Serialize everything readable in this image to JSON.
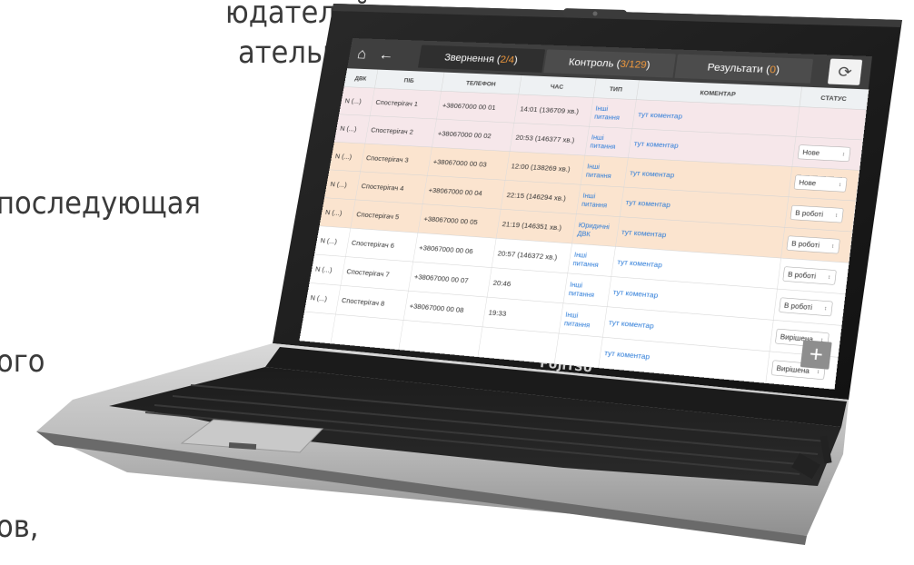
{
  "background_text": [
    {
      "text": "юдателей и"
    },
    {
      "text": "ательных"
    },
    {
      "text": "последующая"
    },
    {
      "text": "ого"
    },
    {
      "text": "ов,"
    }
  ],
  "laptop": {
    "brand": "FUJITSU"
  },
  "app": {
    "tabs": [
      {
        "label_prefix": "Звернення (",
        "highlight": "2/4",
        "label_suffix": ")",
        "active": true
      },
      {
        "label_prefix": "Контроль (",
        "highlight": "3/129",
        "label_suffix": ")",
        "active": false
      },
      {
        "label_prefix": "Результати (",
        "highlight": "0",
        "label_suffix": ")",
        "active": false
      }
    ],
    "columns": [
      "ДВК",
      "ПІБ",
      "ТЕЛЕФОН",
      "ЧАС",
      "ТИП",
      "КОМЕНТАР",
      "СТАТУС"
    ],
    "rows": [
      {
        "dvk": "N (...)",
        "pib": "Спостерігач 1",
        "phone": "+38067000 00 01",
        "time": "14:01 (136709 хв.)",
        "type": "Інші питання",
        "comment": "тут коментар",
        "status": ""
      },
      {
        "dvk": "N (...)",
        "pib": "Спостерігач 2",
        "phone": "+38067000 00 02",
        "time": "20:53 (146377 хв.)",
        "type": "Інші питання",
        "comment": "тут коментар",
        "status": "Нове"
      },
      {
        "dvk": "N (...)",
        "pib": "Спостерігач 3",
        "phone": "+38067000 00 03",
        "time": "12:00 (138269 хв.)",
        "type": "Інші питання",
        "comment": "тут коментар",
        "status": "Нове"
      },
      {
        "dvk": "N (...)",
        "pib": "Спостерігач 4",
        "phone": "+38067000 00 04",
        "time": "22:15 (146294 хв.)",
        "type": "Інші питання",
        "comment": "тут коментар",
        "status": "В роботі"
      },
      {
        "dvk": "N (...)",
        "pib": "Спостерігач 5",
        "phone": "+38067000 00 05",
        "time": "21:19 (146351 хв.)",
        "type": "Юридичні ДВК",
        "comment": "тут коментар",
        "status": "В роботі"
      },
      {
        "dvk": "N (...)",
        "pib": "Спостерігач 6",
        "phone": "+38067000 00 06",
        "time": "20:57 (146372 хв.)",
        "type": "Інші питання",
        "comment": "тут коментар",
        "status": "В роботі"
      },
      {
        "dvk": "N (...)",
        "pib": "Спостерігач 7",
        "phone": "+38067000 00 07",
        "time": "20:46",
        "type": "Інші питання",
        "comment": "тут коментар",
        "status": "В роботі"
      },
      {
        "dvk": "N (...)",
        "pib": "Спостерігач 8",
        "phone": "+38067000 00 08",
        "time": "19:33",
        "type": "Інші питання",
        "comment": "тут коментар",
        "status": "Вирішена"
      },
      {
        "dvk": "",
        "pib": "",
        "phone": "",
        "time": "",
        "type": "",
        "comment": "тут коментар",
        "status": "Вирішена"
      }
    ],
    "fab_label": "+"
  },
  "colors": {
    "app_topbar": "#3f3f3f",
    "highlight": "#f19a3e",
    "link": "#2b7bd8",
    "row_pink": "#f6e7ea",
    "row_peach": "#fbe4cf"
  }
}
